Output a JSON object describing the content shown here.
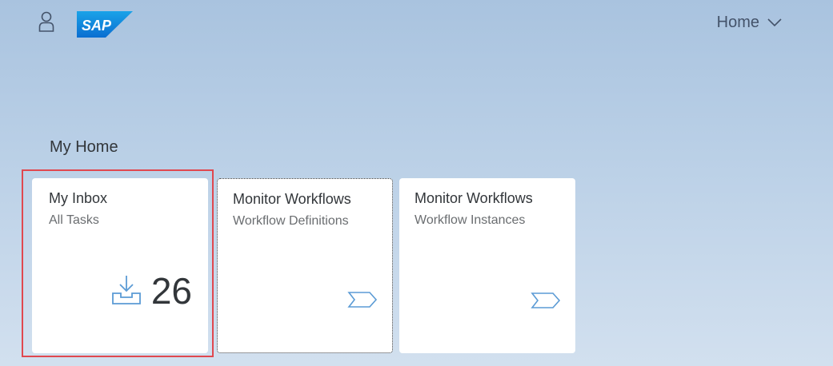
{
  "shell": {
    "logo_text": "SAP",
    "home_menu_label": "Home",
    "brand_color": "#0a6ed1",
    "icons": {
      "user": "person-icon",
      "chevron": "chevron-down-icon"
    }
  },
  "section": {
    "title": "My Home"
  },
  "tiles": [
    {
      "title": "My Inbox",
      "subtitle": "All Tasks",
      "kpi_value": "26",
      "icon": "inbox-download-icon"
    },
    {
      "title": "Monitor Workflows",
      "subtitle": "Workflow Definitions",
      "icon": "process-arrow-icon"
    },
    {
      "title": "Monitor Workflows",
      "subtitle": "Workflow Instances",
      "icon": "process-arrow-icon"
    }
  ],
  "highlight_color": "#e0484f"
}
